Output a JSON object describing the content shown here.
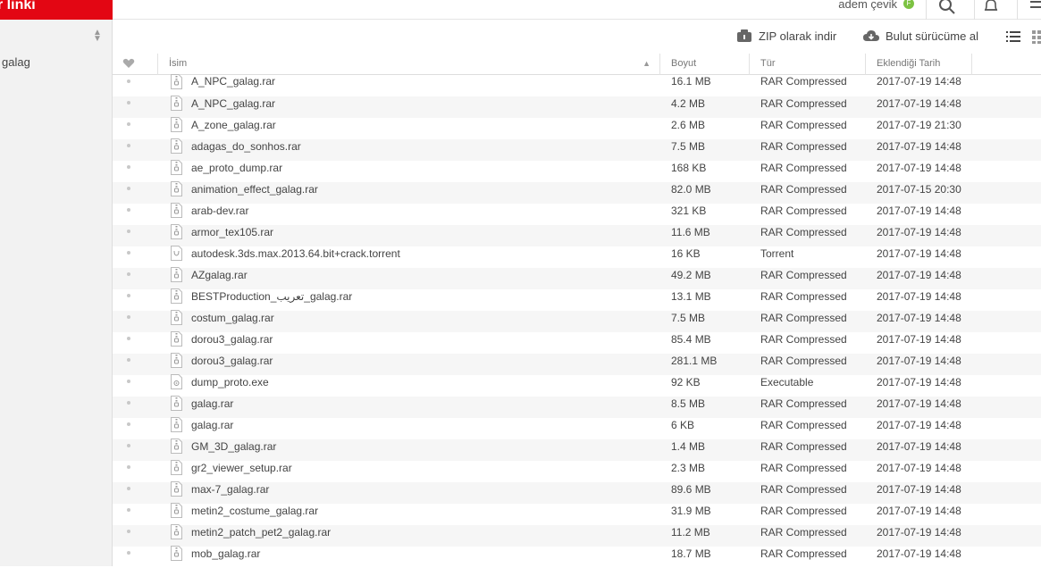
{
  "brand": {
    "title": "r linki"
  },
  "sidebar": {
    "items": [
      {
        "label": "galag"
      }
    ]
  },
  "user": {
    "name": "adem çevik",
    "badge": "F"
  },
  "icons": {
    "search": "search-icon",
    "bell": "bell-icon",
    "menu": "menu-icon"
  },
  "actions": {
    "zip_label": "ZIP olarak indir",
    "cloud_label": "Bulut sürücüme al"
  },
  "columns": {
    "fav": "heart-icon",
    "name": "İsim",
    "size": "Boyut",
    "type": "Tür",
    "date": "Eklendiği Tarih"
  },
  "colors": {
    "brand": "#e30613",
    "badge": "#7cc242"
  },
  "files": [
    {
      "name": "A_NPC_galag.rar",
      "size": "16.1 MB",
      "type": "RAR Compressed",
      "date": "2017-07-19 14:48",
      "icon": "archive-file-icon"
    },
    {
      "name": "A_NPC_galag.rar",
      "size": "4.2 MB",
      "type": "RAR Compressed",
      "date": "2017-07-19 14:48",
      "icon": "archive-file-icon"
    },
    {
      "name": "A_zone_galag.rar",
      "size": "2.6 MB",
      "type": "RAR Compressed",
      "date": "2017-07-19 21:30",
      "icon": "archive-file-icon"
    },
    {
      "name": "adagas_do_sonhos.rar",
      "size": "7.5 MB",
      "type": "RAR Compressed",
      "date": "2017-07-19 14:48",
      "icon": "archive-file-icon"
    },
    {
      "name": "ae_proto_dump.rar",
      "size": "168 KB",
      "type": "RAR Compressed",
      "date": "2017-07-19 14:48",
      "icon": "archive-file-icon"
    },
    {
      "name": "animation_effect_galag.rar",
      "size": "82.0 MB",
      "type": "RAR Compressed",
      "date": "2017-07-15 20:30",
      "icon": "archive-file-icon"
    },
    {
      "name": "arab-dev.rar",
      "size": "321 KB",
      "type": "RAR Compressed",
      "date": "2017-07-19 14:48",
      "icon": "archive-file-icon"
    },
    {
      "name": "armor_tex105.rar",
      "size": "11.6 MB",
      "type": "RAR Compressed",
      "date": "2017-07-19 14:48",
      "icon": "archive-file-icon"
    },
    {
      "name": "autodesk.3ds.max.2013.64.bit+crack.torrent",
      "size": "16 KB",
      "type": "Torrent",
      "date": "2017-07-19 14:48",
      "icon": "torrent-file-icon"
    },
    {
      "name": "AZgalag.rar",
      "size": "49.2 MB",
      "type": "RAR Compressed",
      "date": "2017-07-19 14:48",
      "icon": "archive-file-icon"
    },
    {
      "name": "BESTProduction_تعريب_galag.rar",
      "size": "13.1 MB",
      "type": "RAR Compressed",
      "date": "2017-07-19 14:48",
      "icon": "archive-file-icon"
    },
    {
      "name": "costum_galag.rar",
      "size": "7.5 MB",
      "type": "RAR Compressed",
      "date": "2017-07-19 14:48",
      "icon": "archive-file-icon"
    },
    {
      "name": "dorou3_galag.rar",
      "size": "85.4 MB",
      "type": "RAR Compressed",
      "date": "2017-07-19 14:48",
      "icon": "archive-file-icon"
    },
    {
      "name": "dorou3_galag.rar",
      "size": "281.1 MB",
      "type": "RAR Compressed",
      "date": "2017-07-19 14:48",
      "icon": "archive-file-icon"
    },
    {
      "name": "dump_proto.exe",
      "size": "92 KB",
      "type": "Executable",
      "date": "2017-07-19 14:48",
      "icon": "executable-file-icon"
    },
    {
      "name": "galag.rar",
      "size": "8.5 MB",
      "type": "RAR Compressed",
      "date": "2017-07-19 14:48",
      "icon": "archive-file-icon"
    },
    {
      "name": "galag.rar",
      "size": "6 KB",
      "type": "RAR Compressed",
      "date": "2017-07-19 14:48",
      "icon": "archive-file-icon"
    },
    {
      "name": "GM_3D_galag.rar",
      "size": "1.4 MB",
      "type": "RAR Compressed",
      "date": "2017-07-19 14:48",
      "icon": "archive-file-icon"
    },
    {
      "name": "gr2_viewer_setup.rar",
      "size": "2.3 MB",
      "type": "RAR Compressed",
      "date": "2017-07-19 14:48",
      "icon": "archive-file-icon"
    },
    {
      "name": "max-7_galag.rar",
      "size": "89.6 MB",
      "type": "RAR Compressed",
      "date": "2017-07-19 14:48",
      "icon": "archive-file-icon"
    },
    {
      "name": "metin2_costume_galag.rar",
      "size": "31.9 MB",
      "type": "RAR Compressed",
      "date": "2017-07-19 14:48",
      "icon": "archive-file-icon"
    },
    {
      "name": "metin2_patch_pet2_galag.rar",
      "size": "11.2 MB",
      "type": "RAR Compressed",
      "date": "2017-07-19 14:48",
      "icon": "archive-file-icon"
    },
    {
      "name": "mob_galag.rar",
      "size": "18.7 MB",
      "type": "RAR Compressed",
      "date": "2017-07-19 14:48",
      "icon": "archive-file-icon"
    }
  ]
}
